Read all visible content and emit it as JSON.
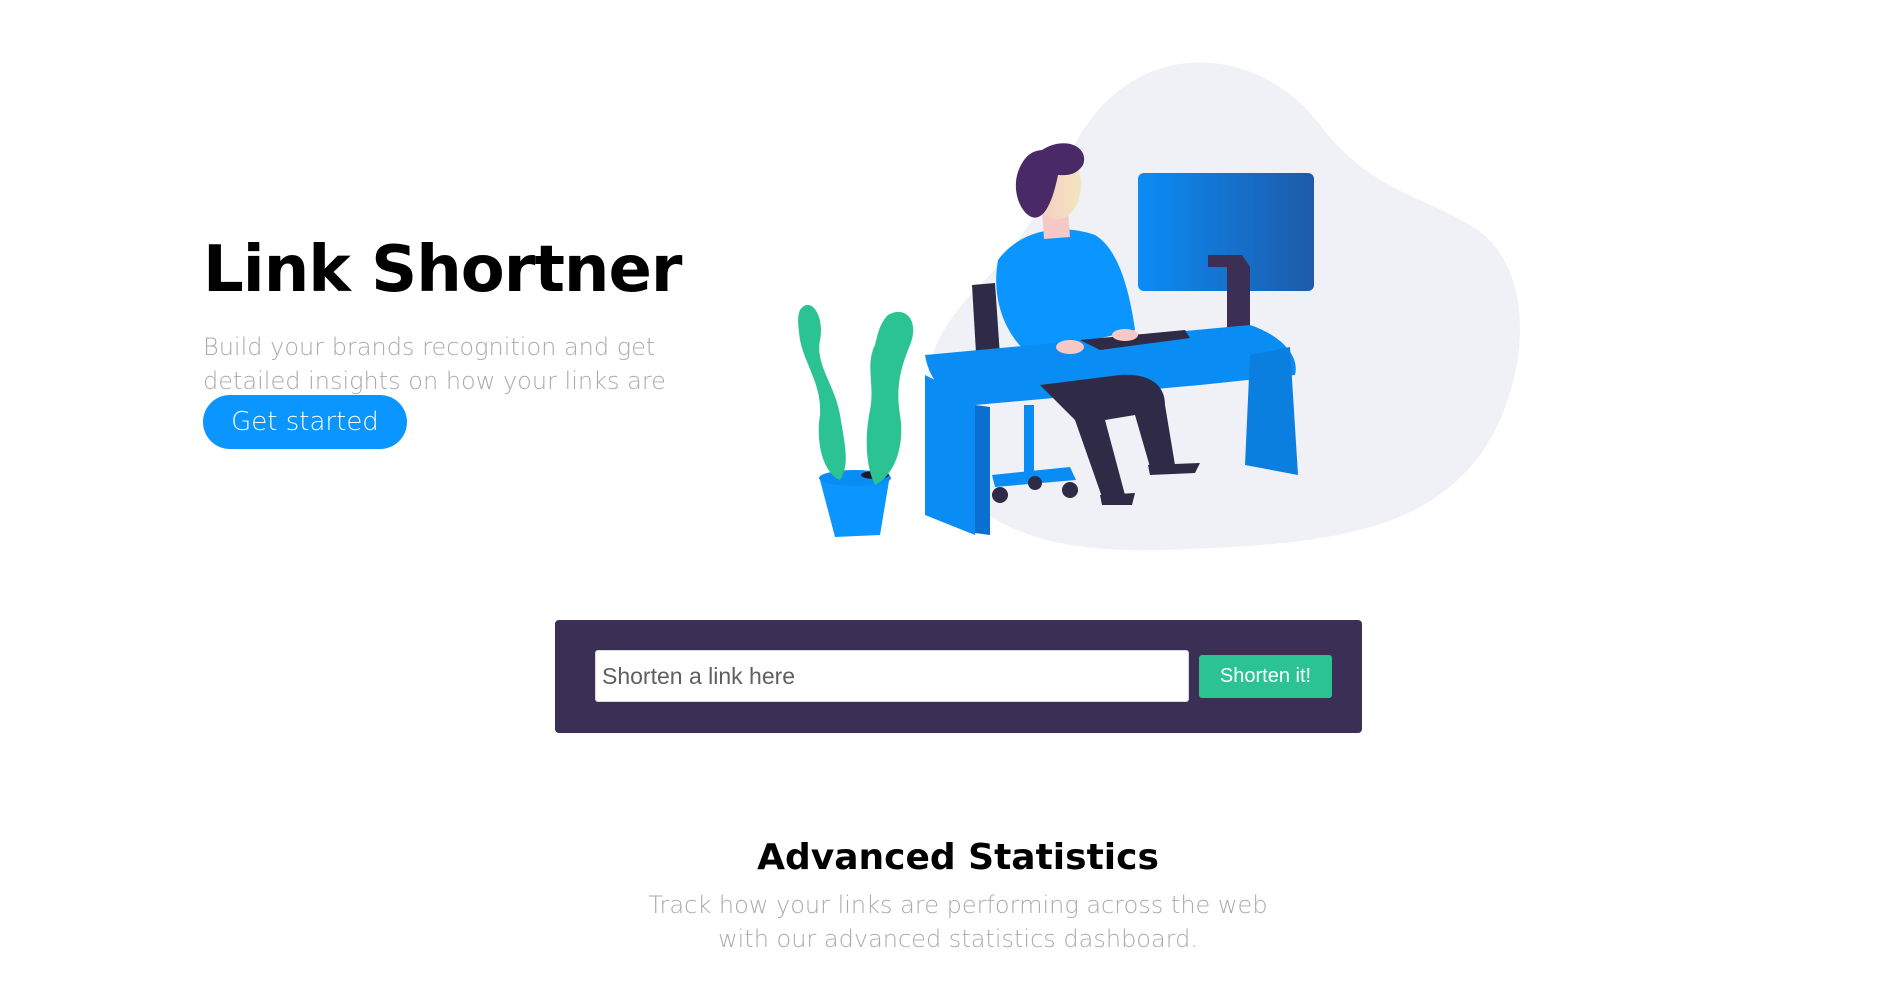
{
  "hero": {
    "title": "Link Shortner",
    "description": "Build your brands recognition and get detailed insights on how your links are performing.",
    "cta_label": "Get started"
  },
  "illustration": {
    "icon": "person-working-at-desk-illustration"
  },
  "shortener": {
    "placeholder": "Shorten a link here",
    "button_label": "Shorten it!"
  },
  "stats": {
    "title": "Advanced Statistics",
    "description": "Track how your links are performing across the web with our advanced statistics dashboard."
  },
  "colors": {
    "accent_blue": "#0a95ff",
    "dark_purple": "#3b2f55",
    "green": "#2bc391",
    "muted_text": "#a9a9b2"
  }
}
